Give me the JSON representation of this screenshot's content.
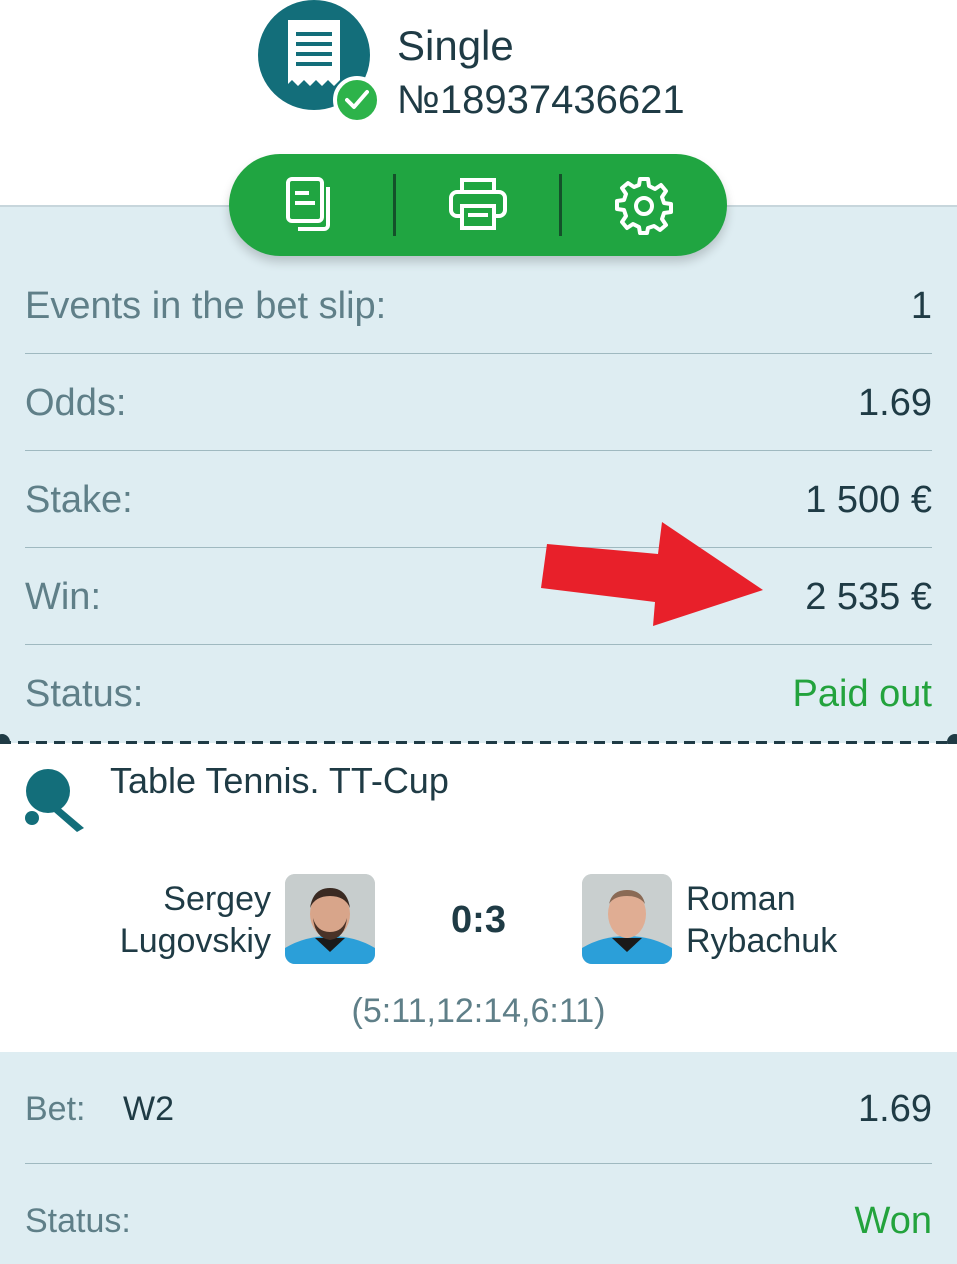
{
  "header": {
    "icon": "receipt-icon",
    "check_icon": "check-icon",
    "title": "Single",
    "ticket_number": "№18937436621"
  },
  "toolbar": {
    "buttons": [
      {
        "icon": "copy-document-icon"
      },
      {
        "icon": "printer-icon"
      },
      {
        "icon": "settings-gear-icon"
      }
    ],
    "color": "#20a541"
  },
  "summary": {
    "rows": [
      {
        "label": "Events in the bet slip:",
        "value": "1"
      },
      {
        "label": "Odds:",
        "value": "1.69"
      },
      {
        "label": "Stake:",
        "value": "1 500 €"
      },
      {
        "label": "Win:",
        "value": "2 535 €"
      },
      {
        "label": "Status:",
        "value": "Paid out"
      }
    ],
    "status_color": "#23a33d",
    "annotation_arrow_color": "#e8202a"
  },
  "event": {
    "sport_icon": "table-tennis-icon",
    "tournament": "Table Tennis. TT-Cup",
    "team1": {
      "line1": "Sergey",
      "line2": "Lugovskiy"
    },
    "team2": {
      "line1": "Roman",
      "line2": "Rybachuk"
    },
    "score": "0:3",
    "sets": "(5:11,12:14,6:11)"
  },
  "bet": {
    "label": "Bet:",
    "selection": "W2",
    "odds": "1.69",
    "status_label": "Status:",
    "status_value": "Won"
  }
}
